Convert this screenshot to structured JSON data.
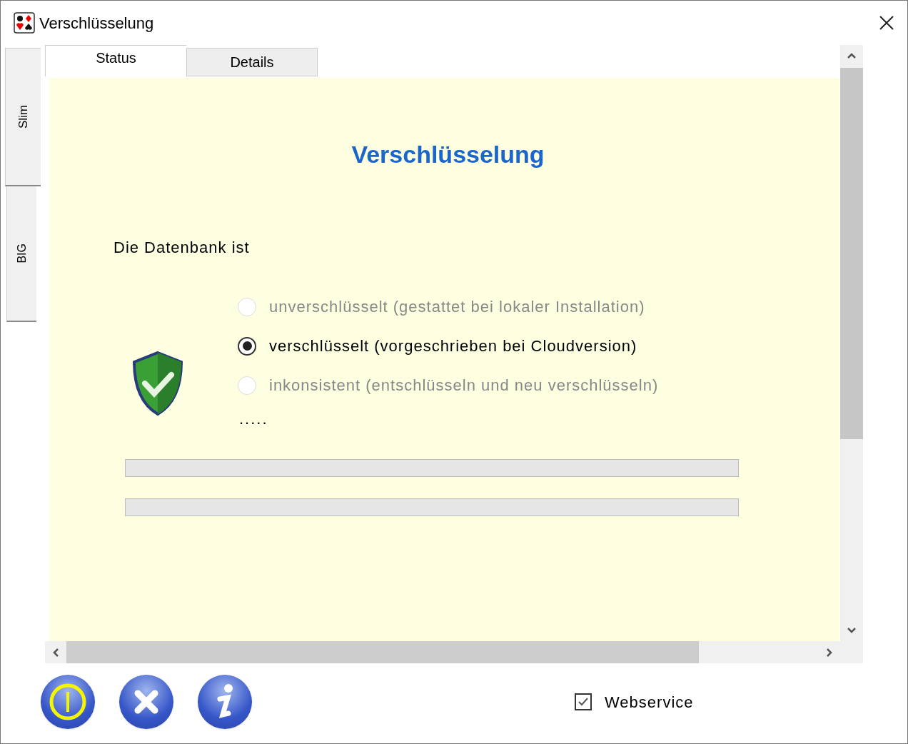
{
  "window": {
    "title": "Verschlüsselung"
  },
  "side_tabs": [
    {
      "label": "Slim",
      "selected": true
    },
    {
      "label": "BIG",
      "selected": false
    }
  ],
  "tabs": [
    {
      "label": "Status",
      "selected": true
    },
    {
      "label": "Details",
      "selected": false
    }
  ],
  "panel": {
    "heading": "Verschlüsselung",
    "intro": "Die Datenbank ist",
    "options": [
      {
        "label": "unverschlüsselt (gestattet bei lokaler Installation)",
        "selected": false,
        "disabled": true
      },
      {
        "label": "verschlüsselt (vorgeschrieben bei Cloudversion)",
        "selected": true,
        "disabled": false
      },
      {
        "label": "inkonsistent (entschlüsseln und neu verschlüsseln)",
        "selected": false,
        "disabled": true
      }
    ],
    "status_text": ".....",
    "progress": [
      {
        "level": 0
      },
      {
        "level": 0
      }
    ]
  },
  "footer": {
    "checkbox": {
      "label": "Webservice",
      "checked": true
    }
  }
}
